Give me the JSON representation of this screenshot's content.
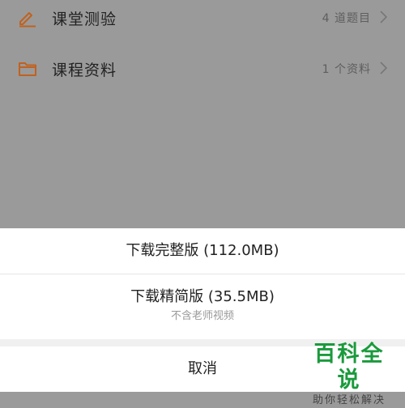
{
  "list": {
    "items": [
      {
        "label": "课堂测验",
        "meta": "4 道题目",
        "icon": "pencil-icon"
      },
      {
        "label": "课程资料",
        "meta": "1 个资料",
        "icon": "folder-icon"
      }
    ]
  },
  "action_sheet": {
    "option_full": "下载完整版 (112.0MB)",
    "option_lite": "下载精简版 (35.5MB)",
    "option_lite_note": "不含老师视频",
    "cancel": "取消"
  },
  "watermark": {
    "title": "百科全说",
    "subtitle": "助你轻松解决"
  },
  "colors": {
    "accent_icon": "#c0621f",
    "overlay_gray": "#9a9a9a",
    "watermark_green": "#1a9a3c"
  }
}
